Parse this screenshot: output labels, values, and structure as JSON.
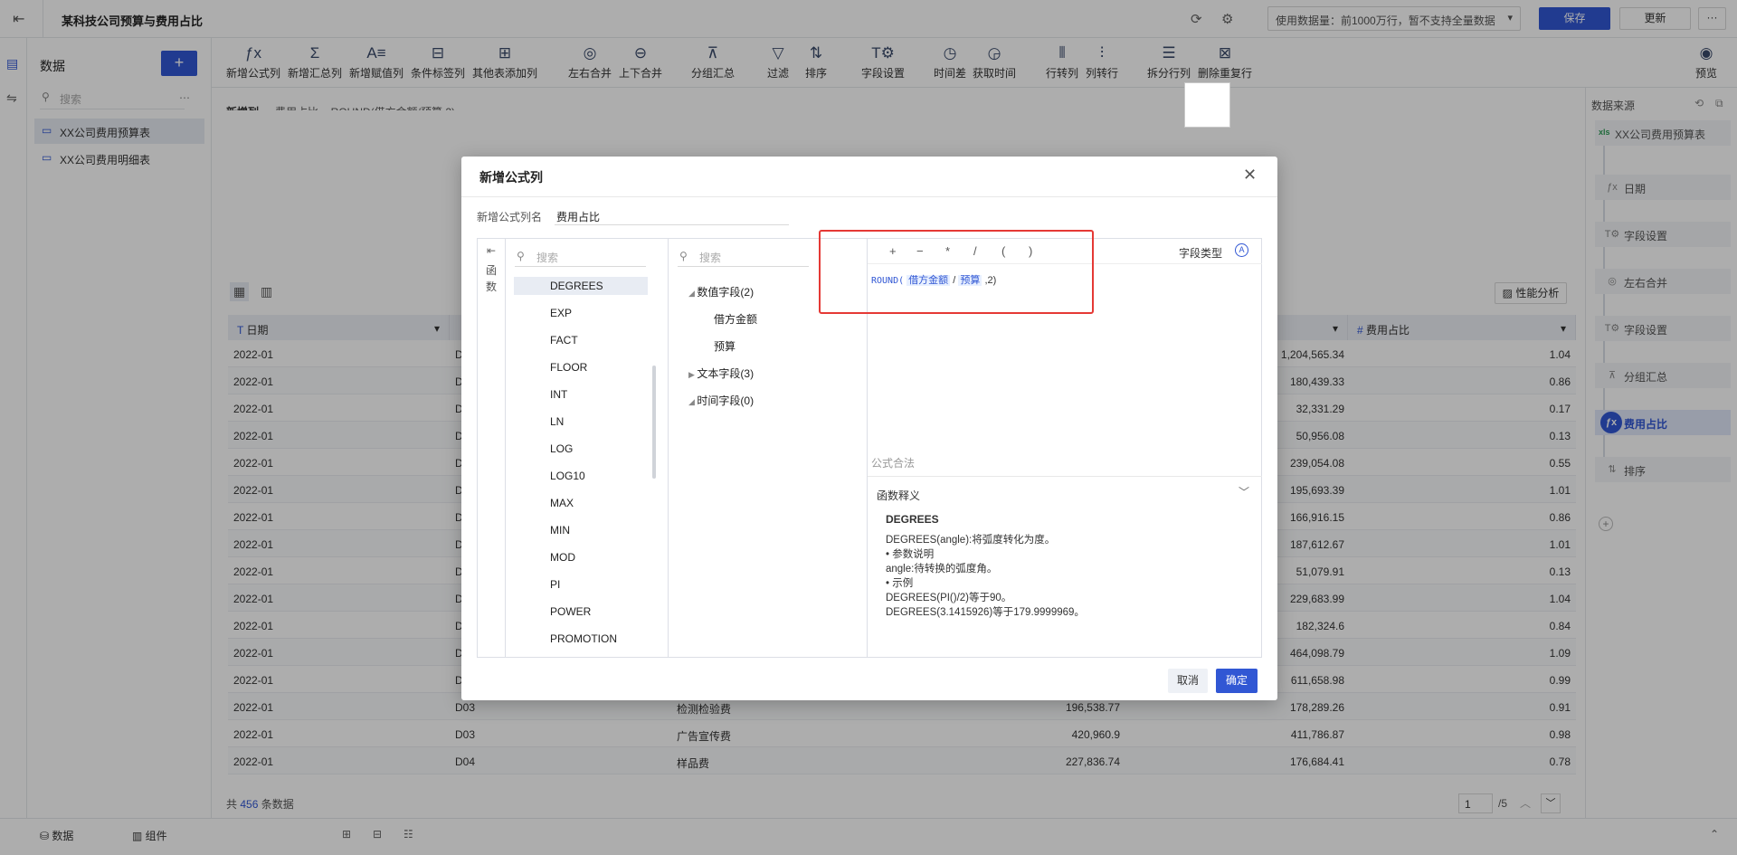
{
  "topbar": {
    "title": "某科技公司预算与费用占比",
    "data_select": "使用数据量：前1000万行，暂不支持全量数据",
    "save": "保存",
    "update": "更新",
    "more": "···"
  },
  "panel": {
    "title": "数据",
    "add": "+",
    "search_placeholder": "搜索",
    "items": [
      "XX公司费用预算表",
      "XX公司费用明细表"
    ]
  },
  "toolbar": {
    "tools": [
      "新增公式列",
      "新增汇总列",
      "新增赋值列",
      "条件标签列",
      "其他表添加列",
      "左右合并",
      "上下合并",
      "分组汇总",
      "过滤",
      "排序",
      "字段设置",
      "时间差",
      "获取时间",
      "行转列",
      "列转行",
      "拆分行列",
      "删除重复行"
    ],
    "preview": "预览"
  },
  "formula_line": {
    "label": "新增列",
    "text": "费用占比 = ROUND(借方金额/预算,2)"
  },
  "table": {
    "headers": {
      "date": "日期",
      "ratio": "费用占比"
    },
    "perf": "性能分析",
    "rows": [
      {
        "date": "2022-01",
        "code": "D",
        "name": "",
        "a": "",
        "b": "1,204,565.34",
        "r": "1.04"
      },
      {
        "date": "2022-01",
        "code": "D",
        "name": "",
        "a": "",
        "b": "180,439.33",
        "r": "0.86"
      },
      {
        "date": "2022-01",
        "code": "D",
        "name": "",
        "a": "",
        "b": "32,331.29",
        "r": "0.17"
      },
      {
        "date": "2022-01",
        "code": "D",
        "name": "",
        "a": "",
        "b": "50,956.08",
        "r": "0.13"
      },
      {
        "date": "2022-01",
        "code": "D",
        "name": "",
        "a": "",
        "b": "239,054.08",
        "r": "0.55"
      },
      {
        "date": "2022-01",
        "code": "D",
        "name": "",
        "a": "",
        "b": "195,693.39",
        "r": "1.01"
      },
      {
        "date": "2022-01",
        "code": "D",
        "name": "",
        "a": "",
        "b": "166,916.15",
        "r": "0.86"
      },
      {
        "date": "2022-01",
        "code": "D",
        "name": "",
        "a": "",
        "b": "187,612.67",
        "r": "1.01"
      },
      {
        "date": "2022-01",
        "code": "D",
        "name": "",
        "a": "",
        "b": "51,079.91",
        "r": "0.13"
      },
      {
        "date": "2022-01",
        "code": "D",
        "name": "",
        "a": "",
        "b": "229,683.99",
        "r": "1.04"
      },
      {
        "date": "2022-01",
        "code": "D",
        "name": "",
        "a": "",
        "b": "182,324.6",
        "r": "0.84"
      },
      {
        "date": "2022-01",
        "code": "D",
        "name": "",
        "a": "",
        "b": "464,098.79",
        "r": "1.09"
      },
      {
        "date": "2022-01",
        "code": "D",
        "name": "",
        "a": "",
        "b": "611,658.98",
        "r": "0.99"
      },
      {
        "date": "2022-01",
        "code": "D03",
        "name": "检测检验费",
        "a": "196,538.77",
        "b": "178,289.26",
        "r": "0.91"
      },
      {
        "date": "2022-01",
        "code": "D03",
        "name": "广告宣传费",
        "a": "420,960.9",
        "b": "411,786.87",
        "r": "0.98"
      },
      {
        "date": "2022-01",
        "code": "D04",
        "name": "样品费",
        "a": "227,836.74",
        "b": "176,684.41",
        "r": "0.78"
      }
    ],
    "footer_prefix": "共",
    "footer_count": "456",
    "footer_suffix": "条数据",
    "page": "1",
    "total_pages": "/5"
  },
  "flow": {
    "title": "数据来源",
    "source": "XX公司费用预算表",
    "nodes": [
      "日期",
      "字段设置",
      "左右合并",
      "字段设置",
      "分组汇总",
      "费用占比",
      "排序"
    ]
  },
  "bottom": {
    "data": "数据",
    "component": "组件"
  },
  "modal": {
    "title": "新增公式列",
    "name_label": "新增公式列名",
    "name_value": "费用占比",
    "side_label": "函数",
    "fn_search": "搜索",
    "functions": [
      "DEGREES",
      "EXP",
      "FACT",
      "FLOOR",
      "INT",
      "LN",
      "LOG",
      "LOG10",
      "MAX",
      "MIN",
      "MOD",
      "PI",
      "POWER",
      "PROMOTION"
    ],
    "field_search": "搜索",
    "numeric_group": "数值字段(2)",
    "numeric_fields": [
      "借方金额",
      "预算"
    ],
    "text_group": "文本字段(3)",
    "time_group": "时间字段(0)",
    "ops": [
      "+",
      "−",
      "*",
      "/",
      "(",
      ")"
    ],
    "field_type": "字段类型",
    "formula_fn": "ROUND(",
    "formula_f1": "借方金额",
    "formula_div": "/",
    "formula_f2": "预算",
    "formula_tail": ",2)",
    "valid": "公式合法",
    "desc_header": "函数释义",
    "desc_title": "DEGREES",
    "desc_lines": [
      "DEGREES(angle):将弧度转化为度。",
      "• 参数说明",
      "angle:待转换的弧度角。",
      "• 示例",
      "DEGREES(PI()/2)等于90。",
      "DEGREES(3.1415926)等于179.9999969。"
    ],
    "cancel": "取消",
    "ok": "确定"
  }
}
